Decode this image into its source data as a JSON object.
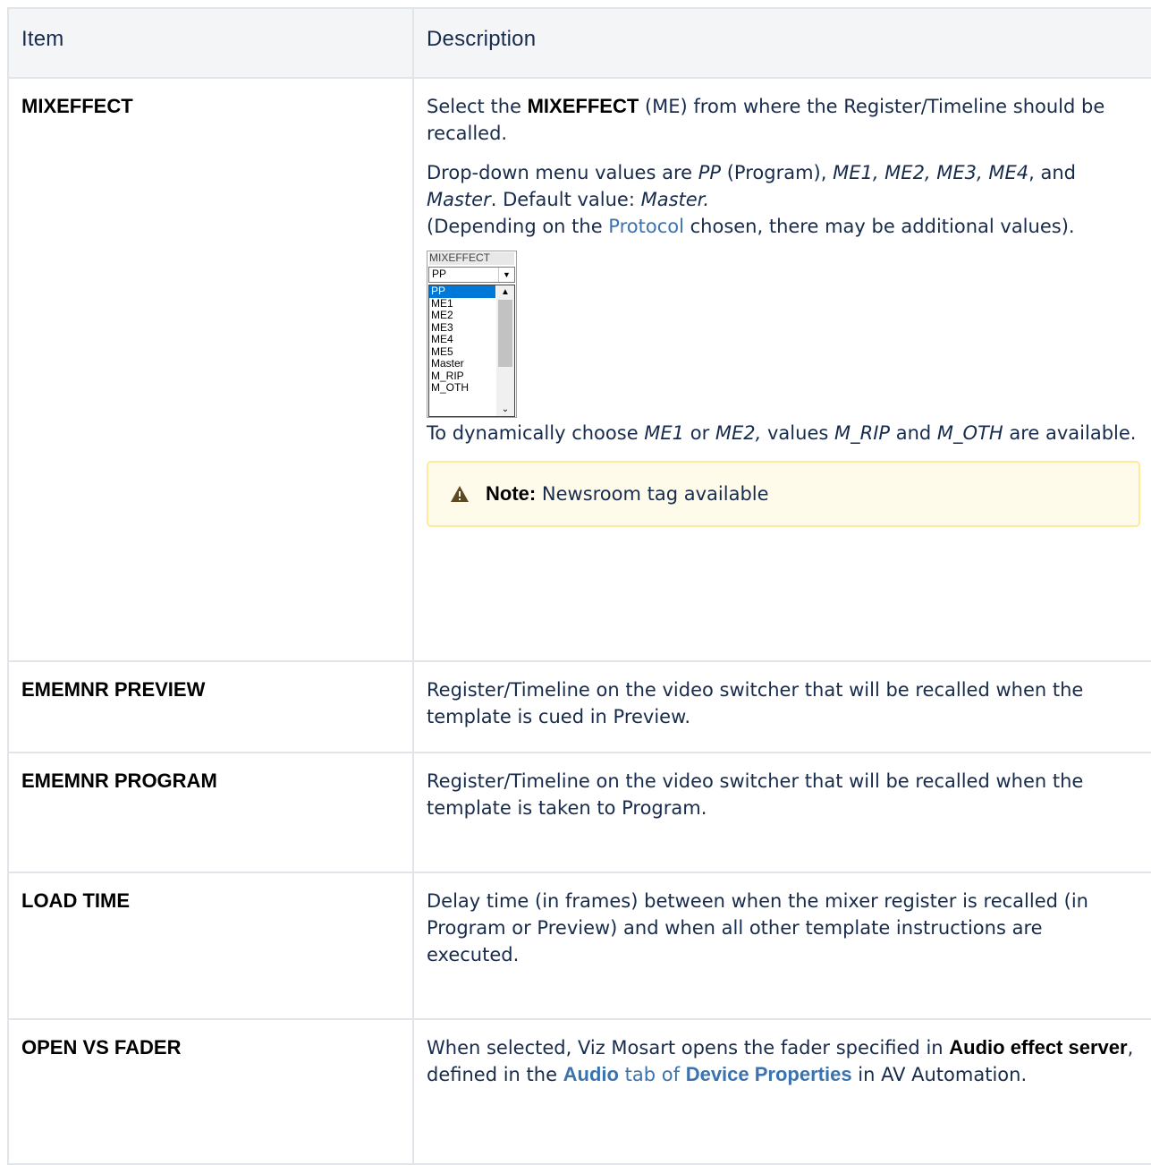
{
  "table": {
    "headers": [
      "Item",
      "Description"
    ],
    "mixeffect": {
      "item": "MIXEFFECT",
      "p1_a": "Select the ",
      "p1_b": "MIXEFFECT",
      "p1_c": " (ME) from where the Register/Timeline should be recalled.",
      "p2_a": "Drop-down menu values are ",
      "p2_b": "PP",
      "p2_c": " (Program), ",
      "p2_d": "ME1, ME2, ME3, ME4",
      "p2_e": ", and ",
      "p2_f": "Master",
      "p2_g": ". Default value: ",
      "p2_h": "Master.",
      "p3_a": "(Depending on the ",
      "p3_link": "Protocol",
      "p3_b": " chosen, there may be additional values).",
      "dropdown": {
        "label": "MIXEFFECT",
        "selected": "PP",
        "options": [
          "PP",
          "ME1",
          "ME2",
          "ME3",
          "ME4",
          "ME5",
          "Master",
          "M_RIP",
          "M_OTH"
        ]
      },
      "p4_a": "To dynamically choose ",
      "p4_b": "ME1",
      "p4_c": " or ",
      "p4_d": "ME2,",
      "p4_e": " values ",
      "p4_f": "M_RIP",
      "p4_g": " and ",
      "p4_h": "M_OTH",
      "p4_i": " are available.",
      "note_label": "Note:",
      "note_text": " Newsroom tag available"
    },
    "ememnr_preview": {
      "item": "EMEMNR PREVIEW",
      "desc": "Register/Timeline on the video switcher that will be recalled when the template is cued in Preview."
    },
    "ememnr_program": {
      "item": "EMEMNR PROGRAM",
      "desc": "Register/Timeline on the video switcher that will be recalled when the template is taken to Program."
    },
    "load_time": {
      "item": "LOAD TIME",
      "desc": "Delay time (in frames) between when the mixer register is recalled (in Program or Preview) and when all other template instructions are executed."
    },
    "open_vs_fader": {
      "item": "OPEN VS FADER",
      "d_a": "When selected, Viz Mosart opens the fader specified in ",
      "d_b": "Audio effect server",
      "d_c": ", defined in the ",
      "d_link1": "Audio",
      "d_link2": " tab of ",
      "d_link3": "Device Properties",
      "d_d": " in AV Automation."
    }
  },
  "colors": {
    "link": "#3b73af",
    "note_border": "#ffe99a",
    "note_bg": "#fffbea",
    "header_bg": "#f4f5f7"
  },
  "icons": {
    "note": "warning-icon",
    "dropdown_arrow": "chevron-down-icon"
  }
}
